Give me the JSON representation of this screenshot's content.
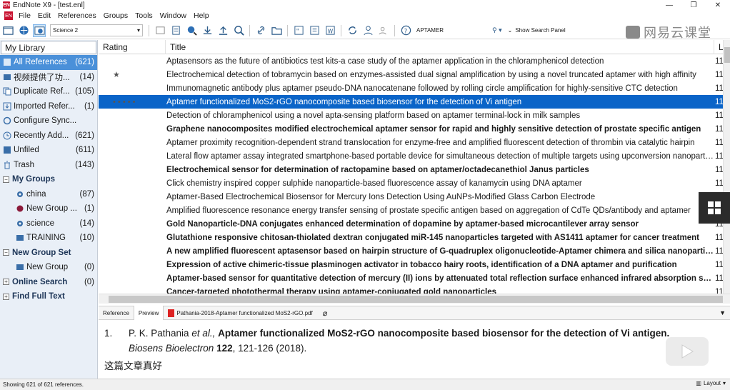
{
  "window": {
    "title": "EndNote X9 - [test.enl]",
    "app_badge": "EN",
    "minimize": "—",
    "restore": "❐",
    "close": "✕"
  },
  "menu": [
    "File",
    "Edit",
    "References",
    "Groups",
    "Tools",
    "Window",
    "Help"
  ],
  "toolbar": {
    "style_name": "Science 2",
    "search_text": "APTAMER",
    "show_search_panel": "Show Search Panel",
    "brand": "网易云课堂"
  },
  "left_pane": {
    "header": "My Library",
    "groups": [
      {
        "label": "All References",
        "count": "(621)",
        "icon": "all-references-icon",
        "selected": true
      },
      {
        "label": "视频提供了功...",
        "count": "(14)",
        "icon": "group-icon"
      },
      {
        "label": "Duplicate Ref...",
        "count": "(105)",
        "icon": "duplicate-icon"
      },
      {
        "label": "Imported Refer...",
        "count": "(1)",
        "icon": "imported-icon"
      },
      {
        "label": "Configure Sync...",
        "count": "",
        "icon": "sync-icon"
      },
      {
        "label": "Recently Add...",
        "count": "(621)",
        "icon": "clock-icon"
      },
      {
        "label": "Unfiled",
        "count": "(611)",
        "icon": "unfiled-icon"
      },
      {
        "label": "Trash",
        "count": "(143)",
        "icon": "trash-icon"
      }
    ],
    "my_groups_label": "My Groups",
    "my_groups": [
      {
        "label": "china",
        "count": "(87)",
        "icon": "smart-group-icon"
      },
      {
        "label": "New Group ...",
        "count": "(1)",
        "icon": "group-icon"
      },
      {
        "label": "science",
        "count": "(14)",
        "icon": "smart-group-icon"
      },
      {
        "label": "TRAINING",
        "count": "(10)",
        "icon": "group-icon"
      }
    ],
    "new_group_set_label": "New Group Set",
    "new_group_set": [
      {
        "label": "New Group",
        "count": "(0)",
        "icon": "group-icon"
      }
    ],
    "online_search_label": "Online Search",
    "online_search_count": "(0)",
    "find_full_text_label": "Find Full Text"
  },
  "ref_list": {
    "columns": [
      "Rating",
      "Title",
      "La"
    ],
    "rows": [
      {
        "rating": "",
        "title": "Aptasensors as the future of antibiotics test kits-a case study of the aptamer application in the chloramphenicol detection",
        "last": "11",
        "bold": false
      },
      {
        "rating": "★",
        "title": "Electrochemical detection of tobramycin based on enzymes-assisted dual signal amplification by using a novel truncated aptamer with high affinity",
        "last": "11",
        "bold": false
      },
      {
        "rating": "",
        "title": "Immunomagnetic antibody plus aptamer pseudo-DNA nanocatenane followed by rolling circle amplification for highly-sensitive CTC detection",
        "last": "11",
        "bold": false
      },
      {
        "rating": "• • • • •",
        "title": "Aptamer functionalized MoS2-rGO nanocomposite based biosensor for the detection of Vi antigen",
        "last": "11",
        "bold": false,
        "selected": true
      },
      {
        "rating": "",
        "title": "Detection of chloramphenicol using a novel apta-sensing platform based on aptamer terminal-lock in milk samples",
        "last": "11",
        "bold": false
      },
      {
        "rating": "",
        "title": "Graphene nanocomposites modified electrochemical aptamer sensor for rapid and highly sensitive detection of prostate specific antigen",
        "last": "11",
        "bold": true
      },
      {
        "rating": "",
        "title": "Aptamer proximity recognition-dependent strand translocation for enzyme-free and amplified fluorescent detection of thrombin via catalytic hairpin",
        "last": "11",
        "bold": false
      },
      {
        "rating": "",
        "title": "Lateral flow aptamer assay integrated smartphone-based portable device for simultaneous detection of multiple targets using upconversion nanoparticles",
        "last": "11",
        "bold": false
      },
      {
        "rating": "",
        "title": "Electrochemical sensor for determination of ractopamine based on aptamer/octadecanethiol Janus particles",
        "last": "11",
        "bold": true
      },
      {
        "rating": "",
        "title": "Click chemistry inspired copper sulphide nanoparticle-based fluorescence assay of kanamycin using DNA aptamer",
        "last": "11",
        "bold": false
      },
      {
        "rating": "",
        "title": "Aptamer-Based Electrochemical Biosensor for Mercury Ions Detection Using AuNPs-Modified Glass Carbon Electrode",
        "last": "11",
        "bold": false
      },
      {
        "rating": "",
        "title": "Amplified fluorescence resonance energy transfer sensing of prostate specific antigen based on aggregation of CdTe QDs/antibody and aptamer",
        "last": "11",
        "bold": false
      },
      {
        "rating": "",
        "title": "Gold Nanoparticle-DNA conjugates enhanced determination of dopamine by aptamer-based microcantilever array sensor",
        "last": "11",
        "bold": true
      },
      {
        "rating": "",
        "title": "Glutathione responsive chitosan-thiolated dextran conjugated miR-145 nanoparticles targeted with AS1411 aptamer for cancer treatment",
        "last": "11",
        "bold": true
      },
      {
        "rating": "",
        "title": "A new amplified fluorescent aptasensor based on hairpin structure of G-quadruplex oligonucleotide-Aptamer chimera and silica nanoparticles",
        "last": "11",
        "bold": true
      },
      {
        "rating": "",
        "title": "Expression of active chimeric-tissue plasminogen activator in tobacco hairy roots, identification of a DNA aptamer and purification",
        "last": "11",
        "bold": true
      },
      {
        "rating": "",
        "title": "Aptamer-based sensor for quantitative detection of mercury (II) ions by attenuated total reflection surface enhanced infrared absorption spectroscopy",
        "last": "11",
        "bold": true
      },
      {
        "rating": "",
        "title": "Cancer-targeted photothermal therapy using aptamer-conjugated gold nanoparticles",
        "last": "11",
        "bold": true
      }
    ]
  },
  "preview_tabs": {
    "reference": "Reference",
    "preview": "Preview",
    "pdf": "Pathania-2018-Aptamer functionalized MoS2-rGO.pdf"
  },
  "preview": {
    "number": "1.",
    "authors": "P. K. Pathania",
    "etal": "et al.,",
    "title": "Aptamer functionalized MoS2-rGO nanocomposite based biosensor for the detection of Vi antigen.",
    "journal": "Biosens Bioelectron",
    "volume": "122",
    "pages_year": ", 121-126 (2018).",
    "note": "这篇文章真好"
  },
  "status": {
    "text": "Showing 621 of 621 references.",
    "layout": "Layout"
  }
}
